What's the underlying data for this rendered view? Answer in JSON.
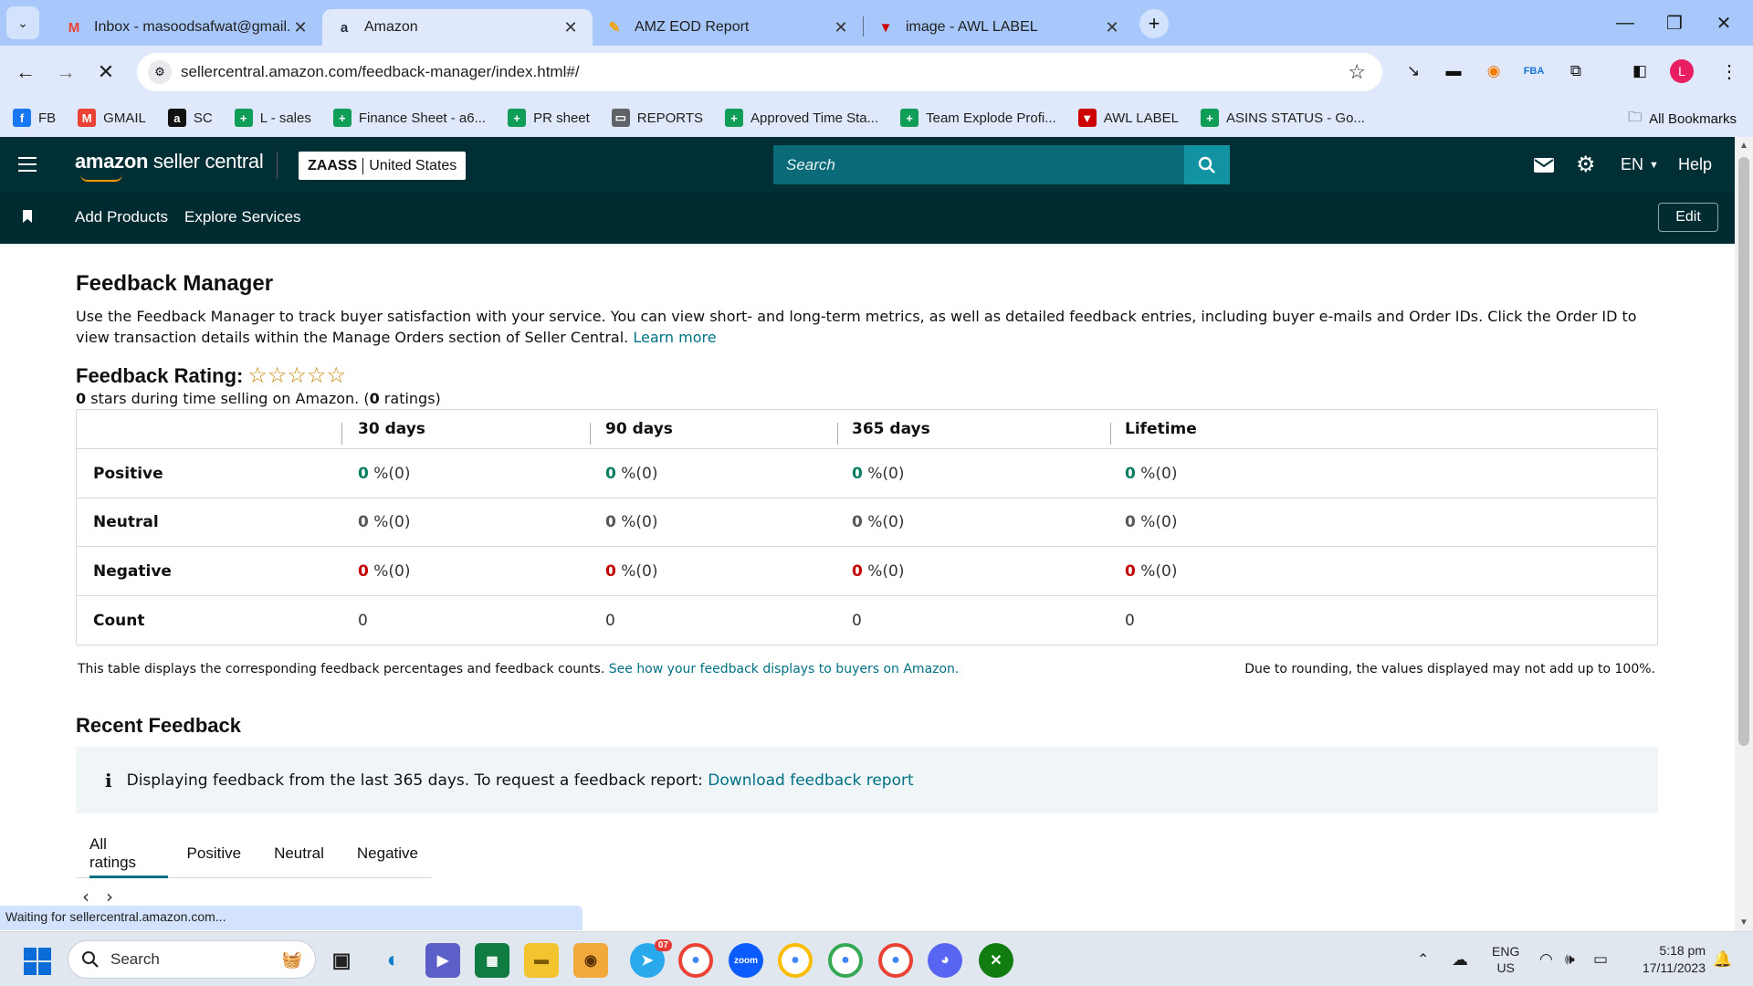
{
  "browser": {
    "tabs": [
      {
        "title": "Inbox - masoodsafwat@gmail.",
        "favicon": "M",
        "fav_color": "#ea4335",
        "active": false
      },
      {
        "title": "Amazon",
        "favicon": "a",
        "fav_color": "#232f3e",
        "active": true
      },
      {
        "title": "AMZ EOD Report",
        "favicon": "✎",
        "fav_color": "#f4a000",
        "active": false
      },
      {
        "title": "image - AWL LABEL",
        "favicon": "▼",
        "fav_color": "#c00",
        "active": false
      }
    ],
    "url": "sellercentral.amazon.com/feedback-manager/index.html#/",
    "bookmarks": [
      {
        "label": "FB",
        "icon": "f",
        "color": "#1877f2"
      },
      {
        "label": "GMAIL",
        "icon": "M",
        "color": "#ea4335"
      },
      {
        "label": "SC",
        "icon": "a",
        "color": "#111"
      },
      {
        "label": "L - sales",
        "icon": "+",
        "color": "#0f9d58"
      },
      {
        "label": "Finance Sheet - a6...",
        "icon": "+",
        "color": "#0f9d58"
      },
      {
        "label": "PR sheet",
        "icon": "+",
        "color": "#0f9d58"
      },
      {
        "label": "REPORTS",
        "icon": "▭",
        "color": "#5f6368"
      },
      {
        "label": "Approved Time Sta...",
        "icon": "+",
        "color": "#0f9d58"
      },
      {
        "label": "Team Explode Profi...",
        "icon": "+",
        "color": "#0f9d58"
      },
      {
        "label": "AWL LABEL",
        "icon": "▼",
        "color": "#c00"
      },
      {
        "label": "ASINS STATUS - Go...",
        "icon": "+",
        "color": "#0f9d58"
      }
    ],
    "all_bookmarks": "All Bookmarks",
    "status": "Waiting for sellercentral.amazon.com...",
    "profile_initial": "L"
  },
  "header": {
    "logo_bold": "amazon",
    "logo_rest": " seller central",
    "store": "ZAASS",
    "marketplace": "United States",
    "search_placeholder": "Search",
    "language": "EN",
    "help": "Help",
    "subnav": [
      "Add Products",
      "Explore Services"
    ],
    "edit": "Edit"
  },
  "page": {
    "title": "Feedback Manager",
    "description": "Use the Feedback Manager to track buyer satisfaction with your service. You can view short- and long-term metrics, as well as detailed feedback entries, including buyer e-mails and Order IDs. Click the Order ID to view transaction details within the Manage Orders section of Seller Central.",
    "learn_more": "Learn more",
    "rating_label": "Feedback Rating:",
    "stars": "☆☆☆☆☆",
    "rating_value": "0",
    "rating_text": " stars during time selling on Amazon. (",
    "rating_count": "0",
    "rating_suffix": " ratings)",
    "columns": [
      "30 days",
      "90 days",
      "365 days",
      "Lifetime"
    ],
    "rows": [
      {
        "label": "Positive",
        "values": [
          "0",
          "0",
          "0",
          "0"
        ],
        "suffix": " %(0)"
      },
      {
        "label": "Neutral",
        "values": [
          "0",
          "0",
          "0",
          "0"
        ],
        "suffix": " %(0)"
      },
      {
        "label": "Negative",
        "values": [
          "0",
          "0",
          "0",
          "0"
        ],
        "suffix": " %(0)"
      },
      {
        "label": "Count",
        "values": [
          "0",
          "0",
          "0",
          "0"
        ],
        "suffix": ""
      }
    ],
    "table_note": "This table displays the corresponding feedback percentages and feedback counts.",
    "table_note_link": "See how your feedback displays to buyers on Amazon.",
    "rounding_note": "Due to rounding, the values displayed may not add up to 100%.",
    "recent_title": "Recent Feedback",
    "alert_icon": "i",
    "alert_text": "Displaying feedback from the last 365 days. To request a feedback report:",
    "alert_link": "Download feedback report",
    "filter_tabs": [
      "All ratings",
      "Positive",
      "Neutral",
      "Negative"
    ]
  },
  "taskbar": {
    "search": "Search",
    "lang1": "ENG",
    "lang2": "US",
    "time": "5:18 pm",
    "date": "17/11/2023",
    "telegram_badge": "07"
  }
}
